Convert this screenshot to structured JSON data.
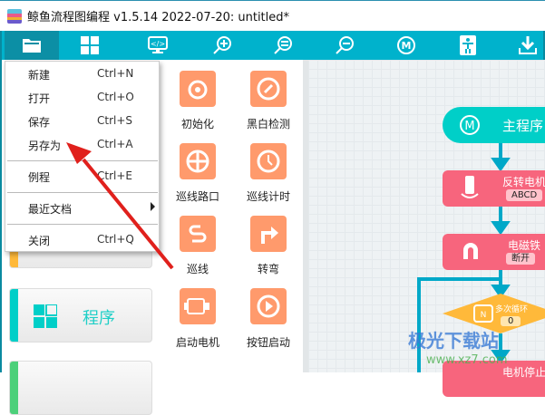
{
  "title": "鲸鱼流程图编程 v1.5.14 2022-07-20:  untitled*",
  "toolbar": [
    "folder-icon",
    "grid-icon",
    "code-monitor-icon",
    "zoom-in-icon",
    "zoom-reset-icon",
    "zoom-out-icon",
    "m-main-icon",
    "robot-icon",
    "download-icon"
  ],
  "menu": {
    "items": [
      {
        "label": "新建",
        "shortcut": "Ctrl+N"
      },
      {
        "label": "打开",
        "shortcut": "Ctrl+O"
      },
      {
        "label": "保存",
        "shortcut": "Ctrl+S"
      },
      {
        "label": "另存为",
        "shortcut": "Ctrl+A"
      },
      {
        "label": "例程",
        "shortcut": "Ctrl+E"
      },
      {
        "label": "最近文档",
        "shortcut": ""
      },
      {
        "label": "关闭",
        "shortcut": "Ctrl+Q"
      }
    ]
  },
  "categories": {
    "program": "程序"
  },
  "palette": [
    "初始化",
    "黑白检测",
    "巡线路口",
    "巡线计时",
    "巡线",
    "转弯",
    "启动电机",
    "按钮启动"
  ],
  "flow": {
    "main": "主程序",
    "b1": {
      "title": "反转电机",
      "value": "ABCD"
    },
    "b2": {
      "title": "电磁铁",
      "value": "断开"
    },
    "loop": {
      "title": "多次循环",
      "value": "0"
    },
    "b3": {
      "title": "电机停止"
    }
  },
  "watermark": {
    "name": "极光下载站",
    "url": "www.xz7.com"
  },
  "colors": {
    "toolbar": "#00b2cc",
    "tile": "#ff9a6c",
    "main": "#00cfc8",
    "block": "#f7657d",
    "loop": "#ffb93a",
    "arrow": "#e0201c"
  }
}
